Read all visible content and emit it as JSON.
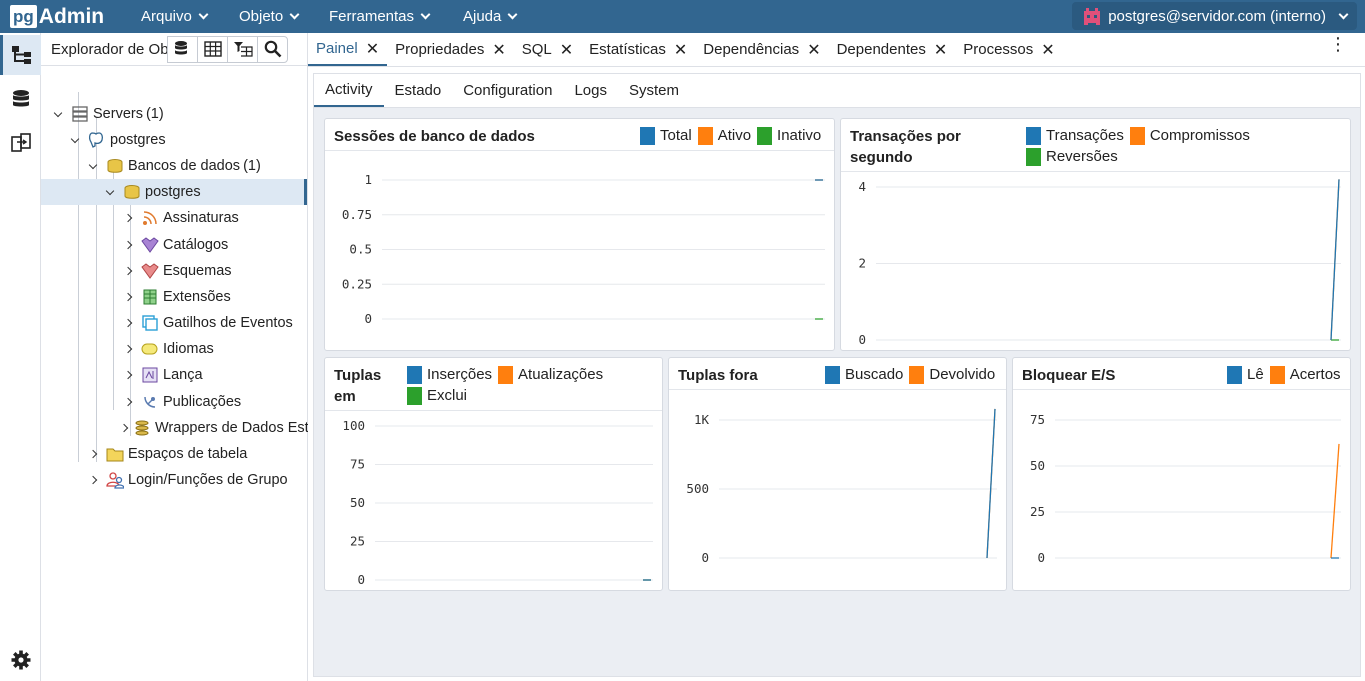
{
  "app": {
    "logo_pg": "pg",
    "logo_admin": "Admin"
  },
  "menu": [
    {
      "label": "Arquivo"
    },
    {
      "label": "Objeto"
    },
    {
      "label": "Ferramentas"
    },
    {
      "label": "Ajuda"
    }
  ],
  "user": {
    "label": "postgres@servidor.com (interno)"
  },
  "explorer": {
    "title": "Explorador de Objetos",
    "tree": [
      {
        "label": "Servers",
        "count": "(1)"
      },
      {
        "label": "postgres"
      },
      {
        "label": "Bancos de dados",
        "count": "(1)"
      },
      {
        "label": "postgres"
      },
      {
        "label": "Assinaturas"
      },
      {
        "label": "Catálogos"
      },
      {
        "label": "Esquemas"
      },
      {
        "label": "Extensões"
      },
      {
        "label": "Gatilhos de Eventos"
      },
      {
        "label": "Idiomas"
      },
      {
        "label": "Lança"
      },
      {
        "label": "Publicações"
      },
      {
        "label": "Wrappers de Dados Estrangeiros"
      },
      {
        "label": "Espaços de tabela"
      },
      {
        "label": "Login/Funções de Grupo"
      }
    ]
  },
  "tabs": [
    {
      "label": "Painel"
    },
    {
      "label": "Propriedades"
    },
    {
      "label": "SQL"
    },
    {
      "label": "Estatísticas"
    },
    {
      "label": "Dependências"
    },
    {
      "label": "Dependentes"
    },
    {
      "label": "Processos"
    }
  ],
  "subtabs": [
    {
      "label": "Activity"
    },
    {
      "label": "Estado"
    },
    {
      "label": "Configuration"
    },
    {
      "label": "Logs"
    },
    {
      "label": "System"
    }
  ],
  "colors": {
    "blue": "#1f77b4",
    "orange": "#ff7f0e",
    "green": "#2ca02c",
    "brand": "#326690"
  },
  "chart_data": [
    {
      "type": "line",
      "title": "Sessões de banco de dados",
      "yticks": [
        "1",
        "0.75",
        "0.5",
        "0.25",
        "0"
      ],
      "ylim": [
        0,
        1
      ],
      "series": [
        {
          "name": "Total",
          "color": "#1f77b4",
          "values": [
            1,
            1
          ]
        },
        {
          "name": "Ativo",
          "color": "#ff7f0e",
          "values": [
            1,
            1
          ]
        },
        {
          "name": "Inativo",
          "color": "#2ca02c",
          "values": [
            0,
            0
          ]
        }
      ]
    },
    {
      "type": "line",
      "title": "Transações por segundo",
      "yticks": [
        "4",
        "2",
        "0"
      ],
      "ylim": [
        0,
        5
      ],
      "series": [
        {
          "name": "Transações",
          "color": "#1f77b4",
          "values": [
            0,
            4.2
          ]
        },
        {
          "name": "Compromissos",
          "color": "#ff7f0e",
          "values": [
            0,
            4.2
          ]
        },
        {
          "name": "Reversões",
          "color": "#2ca02c",
          "values": [
            0,
            0
          ]
        }
      ]
    },
    {
      "type": "line",
      "title": "Tuplas em",
      "yticks": [
        "100",
        "75",
        "50",
        "25",
        "0"
      ],
      "ylim": [
        0,
        100
      ],
      "series": [
        {
          "name": "Inserções",
          "color": "#1f77b4",
          "values": [
            0,
            0
          ]
        },
        {
          "name": "Atualizações",
          "color": "#ff7f0e",
          "values": [
            0,
            0
          ]
        },
        {
          "name": "Exclui",
          "color": "#2ca02c",
          "values": [
            0,
            0
          ]
        }
      ]
    },
    {
      "type": "line",
      "title": "Tuplas fora",
      "yticks": [
        "1K",
        "500",
        "0"
      ],
      "ylim": [
        0,
        1300
      ],
      "series": [
        {
          "name": "Buscado",
          "color": "#1f77b4",
          "values": [
            0,
            1220
          ]
        },
        {
          "name": "Devolvido",
          "color": "#ff7f0e",
          "values": [
            0,
            1220
          ]
        }
      ]
    },
    {
      "type": "line",
      "title": "Bloquear E/S",
      "yticks": [
        "75",
        "50",
        "25",
        "0"
      ],
      "ylim": [
        0,
        90
      ],
      "series": [
        {
          "name": "Lê",
          "color": "#1f77b4",
          "values": [
            0,
            0
          ]
        },
        {
          "name": "Acertos",
          "color": "#ff7f0e",
          "values": [
            0,
            62
          ]
        }
      ]
    }
  ]
}
